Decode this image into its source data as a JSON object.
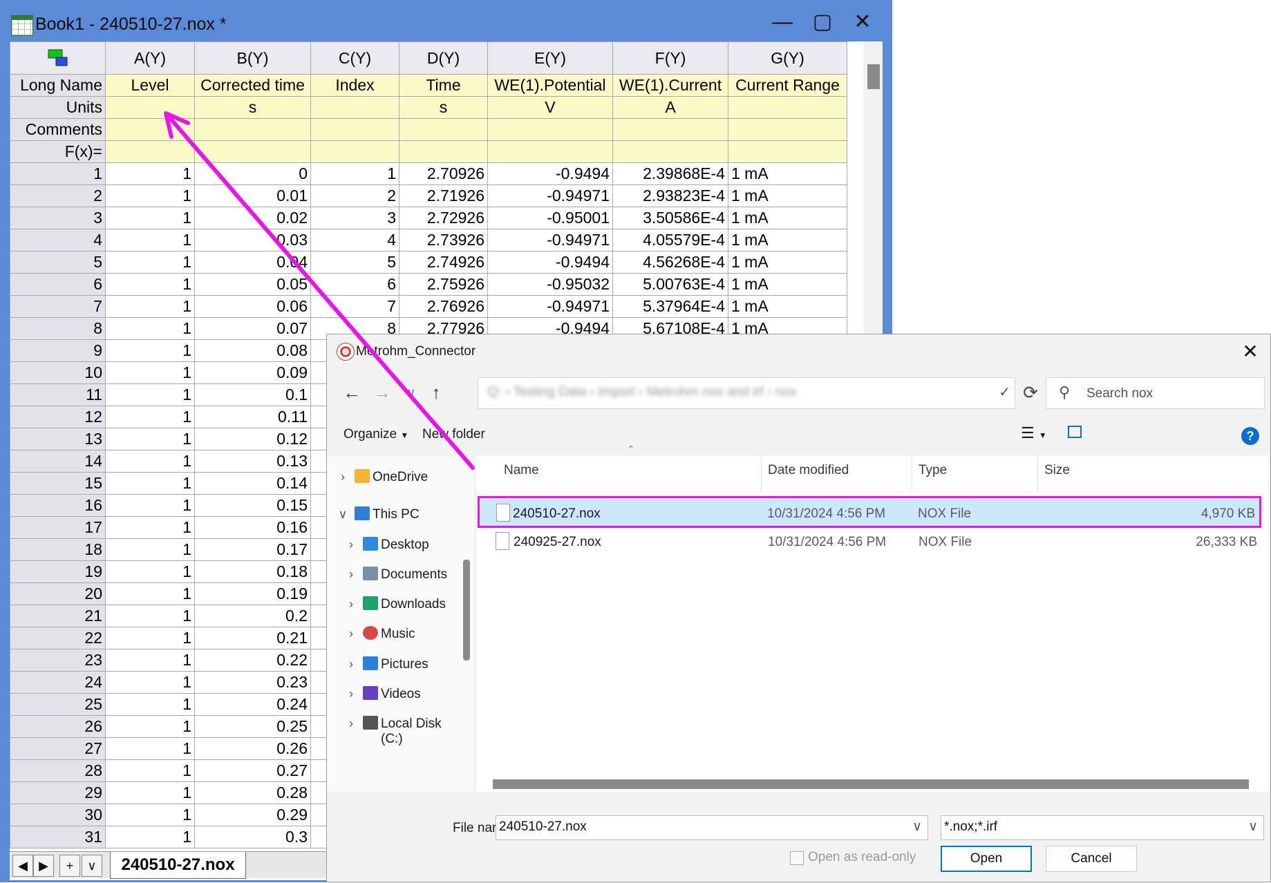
{
  "workbook": {
    "title": "Book1 - 240510-27.nox *",
    "columns": [
      "A(Y)",
      "B(Y)",
      "C(Y)",
      "D(Y)",
      "E(Y)",
      "F(Y)",
      "G(Y)"
    ],
    "row_labels": {
      "long_name": "Long Name",
      "units": "Units",
      "comments": "Comments",
      "fx": "F(x)="
    },
    "long_names": [
      "Level",
      "Corrected time",
      "Index",
      "Time",
      "WE(1).Potential",
      "WE(1).Current",
      "Current Range"
    ],
    "units": [
      "",
      "s",
      "",
      "s",
      "V",
      "A",
      ""
    ],
    "rows": [
      [
        "1",
        "1",
        "0",
        "1",
        "2.70926",
        "-0.9494",
        "2.39868E-4",
        "1 mA"
      ],
      [
        "2",
        "1",
        "0.01",
        "2",
        "2.71926",
        "-0.94971",
        "2.93823E-4",
        "1 mA"
      ],
      [
        "3",
        "1",
        "0.02",
        "3",
        "2.72926",
        "-0.95001",
        "3.50586E-4",
        "1 mA"
      ],
      [
        "4",
        "1",
        "0.03",
        "4",
        "2.73926",
        "-0.94971",
        "4.05579E-4",
        "1 mA"
      ],
      [
        "5",
        "1",
        "0.04",
        "5",
        "2.74926",
        "-0.9494",
        "4.56268E-4",
        "1 mA"
      ],
      [
        "6",
        "1",
        "0.05",
        "6",
        "2.75926",
        "-0.95032",
        "5.00763E-4",
        "1 mA"
      ],
      [
        "7",
        "1",
        "0.06",
        "7",
        "2.76926",
        "-0.94971",
        "5.37964E-4",
        "1 mA"
      ],
      [
        "8",
        "1",
        "0.07",
        "8",
        "2.77926",
        "-0.9494",
        "5.67108E-4",
        "1 mA"
      ],
      [
        "9",
        "1",
        "0.08",
        "",
        "",
        "",
        "",
        ""
      ],
      [
        "10",
        "1",
        "0.09",
        "",
        "",
        "",
        "",
        ""
      ],
      [
        "11",
        "1",
        "0.1",
        "",
        "",
        "",
        "",
        ""
      ],
      [
        "12",
        "1",
        "0.11",
        "",
        "",
        "",
        "",
        ""
      ],
      [
        "13",
        "1",
        "0.12",
        "",
        "",
        "",
        "",
        ""
      ],
      [
        "14",
        "1",
        "0.13",
        "",
        "",
        "",
        "",
        ""
      ],
      [
        "15",
        "1",
        "0.14",
        "",
        "",
        "",
        "",
        ""
      ],
      [
        "16",
        "1",
        "0.15",
        "",
        "",
        "",
        "",
        ""
      ],
      [
        "17",
        "1",
        "0.16",
        "",
        "",
        "",
        "",
        ""
      ],
      [
        "18",
        "1",
        "0.17",
        "",
        "",
        "",
        "",
        ""
      ],
      [
        "19",
        "1",
        "0.18",
        "",
        "",
        "",
        "",
        ""
      ],
      [
        "20",
        "1",
        "0.19",
        "",
        "",
        "",
        "",
        ""
      ],
      [
        "21",
        "1",
        "0.2",
        "",
        "",
        "",
        "",
        ""
      ],
      [
        "22",
        "1",
        "0.21",
        "",
        "",
        "",
        "",
        ""
      ],
      [
        "23",
        "1",
        "0.22",
        "",
        "",
        "",
        "",
        ""
      ],
      [
        "24",
        "1",
        "0.23",
        "",
        "",
        "",
        "",
        ""
      ],
      [
        "25",
        "1",
        "0.24",
        "",
        "",
        "",
        "",
        ""
      ],
      [
        "26",
        "1",
        "0.25",
        "",
        "",
        "",
        "",
        ""
      ],
      [
        "27",
        "1",
        "0.26",
        "",
        "",
        "",
        "",
        ""
      ],
      [
        "28",
        "1",
        "0.27",
        "",
        "",
        "",
        "",
        ""
      ],
      [
        "29",
        "1",
        "0.28",
        "",
        "",
        "",
        "",
        ""
      ],
      [
        "30",
        "1",
        "0.29",
        "",
        "",
        "",
        "",
        ""
      ],
      [
        "31",
        "1",
        "0.3",
        "",
        "",
        "",
        "",
        ""
      ]
    ],
    "sheet_tab": "240510-27.nox",
    "nav_buttons": [
      "◀",
      "▶",
      "+",
      "∨"
    ]
  },
  "dialog": {
    "title": "Metrohm_Connector",
    "address_blurred": "Q:  ›  Testing Data  ›  Import  ›  Metrohm nox and irf  ›  nox",
    "search_placeholder": "Search nox",
    "organize_label": "Organize",
    "new_folder_label": "New folder",
    "nav_items": [
      {
        "label": "OneDrive",
        "icon": "folder-icon"
      },
      {
        "label": "This PC",
        "icon": "monitor-icon"
      },
      {
        "label": "Desktop",
        "icon": "desktop-icon"
      },
      {
        "label": "Documents",
        "icon": "documents-icon"
      },
      {
        "label": "Downloads",
        "icon": "download-icon"
      },
      {
        "label": "Music",
        "icon": "music-icon"
      },
      {
        "label": "Pictures",
        "icon": "pictures-icon"
      },
      {
        "label": "Videos",
        "icon": "videos-icon"
      },
      {
        "label": "Local Disk (C:)",
        "icon": "disk-icon"
      }
    ],
    "file_headers": {
      "name": "Name",
      "date": "Date modified",
      "type": "Type",
      "size": "Size"
    },
    "files": [
      {
        "name": "240510-27.nox",
        "date": "10/31/2024 4:56 PM",
        "type": "NOX File",
        "size": "4,970 KB",
        "selected": true
      },
      {
        "name": "240925-27.nox",
        "date": "10/31/2024 4:56 PM",
        "type": "NOX File",
        "size": "26,333 KB",
        "selected": false
      }
    ],
    "file_name_label": "File name:",
    "file_name_value": "240510-27.nox",
    "file_type_value": "*.nox;*.irf",
    "read_only_label": "Open as read-only",
    "open_label": "Open",
    "cancel_label": "Cancel"
  },
  "colors": {
    "window_frame": "#5b8bd6",
    "meta_row_bg": "#fbfbc8",
    "annotation": "#e815e8",
    "selected_row": "#cce8ff",
    "accent": "#0a6ed1"
  }
}
